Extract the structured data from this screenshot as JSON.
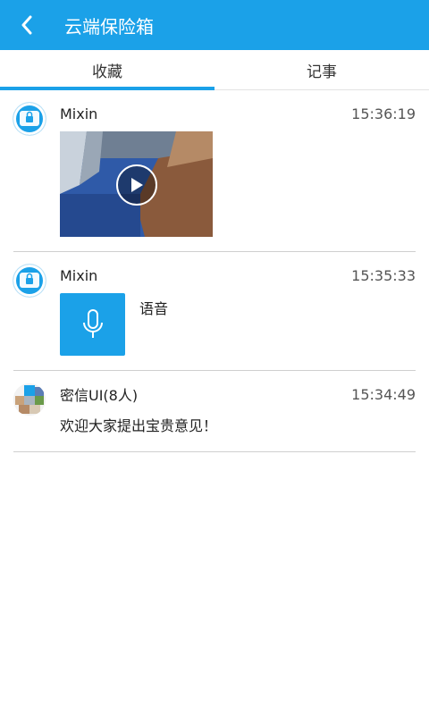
{
  "header": {
    "title": "云端保险箱"
  },
  "tabs": [
    {
      "label": "收藏",
      "active": true
    },
    {
      "label": "记事",
      "active": false
    }
  ],
  "items": [
    {
      "sender": "Mixin",
      "time": "15:36:19",
      "type": "video"
    },
    {
      "sender": "Mixin",
      "time": "15:35:33",
      "type": "voice",
      "voice_label": "语音"
    },
    {
      "sender": "密信UI(8人)",
      "time": "15:34:49",
      "type": "text",
      "text": "欢迎大家提出宝贵意见！"
    }
  ],
  "colors": {
    "accent": "#1ba1e8"
  }
}
